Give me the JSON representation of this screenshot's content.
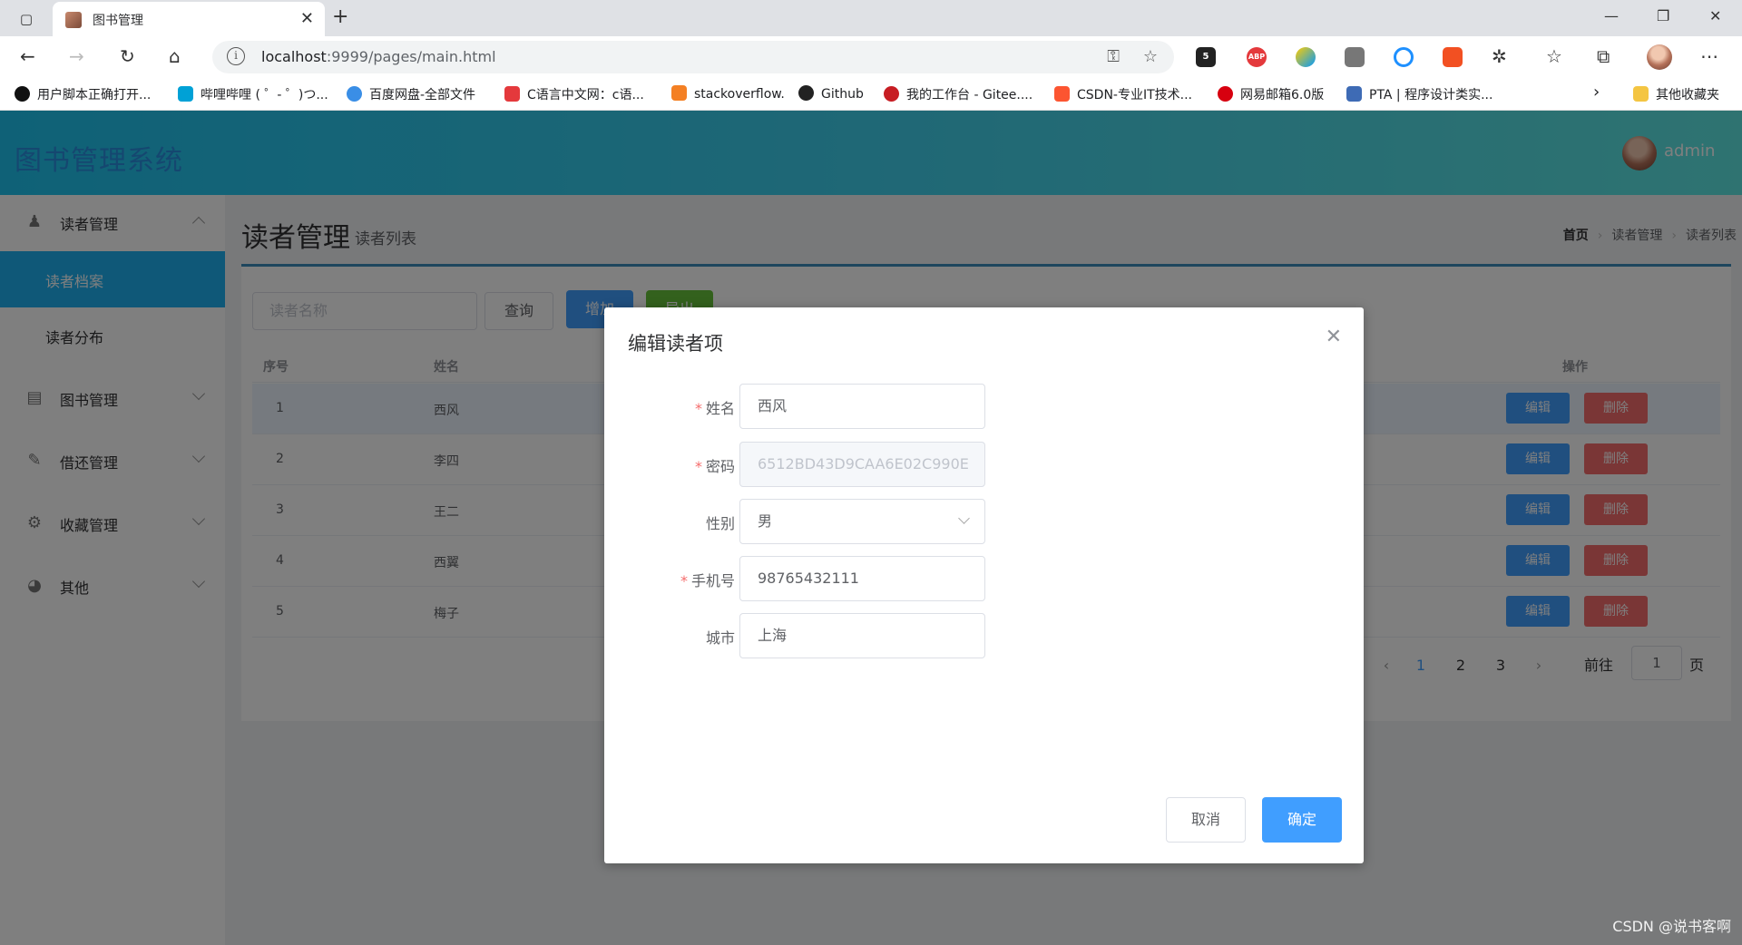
{
  "browser": {
    "tab_title": "图书管理",
    "url_host": "localhost",
    "url_rest": ":9999/pages/main.html",
    "extension_badge": "5",
    "abp_label": "ABP",
    "bookmarks": [
      "用户脚本正确打开...",
      "哔哩哔哩 ( ゜- ゜)つ...",
      "百度网盘-全部文件",
      "C语言中文网：c语...",
      "stackoverflow.",
      "Github",
      "我的工作台 - Gitee....",
      "CSDN-专业IT技术...",
      "网易邮箱6.0版",
      "PTA | 程序设计类实...",
      "其他收藏夹"
    ]
  },
  "app": {
    "title": "图书管理系统",
    "user_name": "admin"
  },
  "sidebar": {
    "menus": [
      {
        "label": "读者管理",
        "icon": "user-icon",
        "expanded": true
      },
      {
        "label": "图书管理",
        "icon": "book-icon"
      },
      {
        "label": "借还管理",
        "icon": "pencil-icon"
      },
      {
        "label": "收藏管理",
        "icon": "gear-icon"
      },
      {
        "label": "其他",
        "icon": "palette-icon"
      }
    ],
    "sub_items": [
      {
        "label": "读者档案",
        "active": true
      },
      {
        "label": "读者分布"
      }
    ]
  },
  "content": {
    "page_title": "读者管理",
    "page_subtitle": "读者列表",
    "breadcrumb": [
      "首页",
      "读者管理",
      "读者列表"
    ],
    "search_placeholder": "读者名称",
    "query_label": "查询",
    "add_label": "增加",
    "export_label": "导出",
    "columns": [
      "序号",
      "姓名",
      "操作"
    ],
    "rows": [
      {
        "index": "1",
        "name": "西风"
      },
      {
        "index": "2",
        "name": "李四"
      },
      {
        "index": "3",
        "name": "王二"
      },
      {
        "index": "4",
        "name": "西翼"
      },
      {
        "index": "5",
        "name": "梅子"
      }
    ],
    "edit_label": "编辑",
    "delete_label": "删除",
    "pagination": {
      "pages": [
        "1",
        "2",
        "3"
      ],
      "current": "1",
      "goto_prefix": "前往",
      "goto_value": "1",
      "goto_suffix": "页"
    }
  },
  "dialog": {
    "title": "编辑读者项",
    "fields": [
      {
        "label": "姓名",
        "required": true,
        "value": "西风"
      },
      {
        "label": "密码",
        "required": true,
        "value": "6512BD43D9CAA6E02C990E",
        "disabled": true
      },
      {
        "label": "性别",
        "required": false,
        "value": "男",
        "type": "select"
      },
      {
        "label": "手机号",
        "required": true,
        "value": "98765432111"
      },
      {
        "label": "城市",
        "required": false,
        "value": "上海"
      }
    ],
    "required_mark": "*",
    "cancel_label": "取消",
    "confirm_label": "确定"
  },
  "watermark": "CSDN @说书客啊",
  "colors": {
    "primary": "#409eff",
    "danger": "#f56c6c",
    "success": "#67c23a",
    "active_menu": "#1fb1f0"
  }
}
